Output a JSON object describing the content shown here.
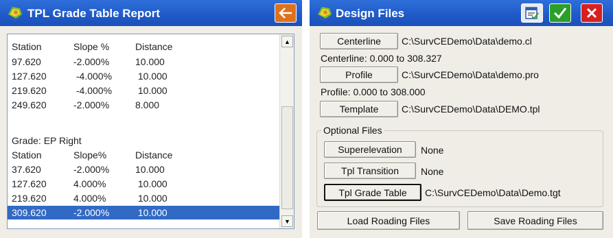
{
  "report_window": {
    "title": "TPL Grade Table Report",
    "rows": [
      {
        "station": "Station",
        "slope": "Slope %",
        "distance": "Distance"
      },
      {
        "station": "97.620",
        "slope": "-2.000%",
        "distance": "10.000"
      },
      {
        "station": "127.620",
        "slope": " -4.000%",
        "distance": " 10.000"
      },
      {
        "station": "219.620",
        "slope": " -4.000%",
        "distance": " 10.000"
      },
      {
        "station": "249.620",
        "slope": "-2.000%",
        "distance": "8.000"
      },
      {
        "station": "",
        "slope": "",
        "distance": ""
      },
      {
        "station": "Grade: EP Right",
        "slope": "",
        "distance": ""
      },
      {
        "station": "Station",
        "slope": "Slope%",
        "distance": "Distance"
      },
      {
        "station": "37.620",
        "slope": "-2.000%",
        "distance": "10.000"
      },
      {
        "station": "127.620",
        "slope": "4.000%",
        "distance": " 10.000"
      },
      {
        "station": "219.620",
        "slope": "4.000%",
        "distance": " 10.000"
      },
      {
        "station": "309.620",
        "slope": "-2.000%",
        "distance": " 10.000"
      }
    ],
    "selected_row": 11
  },
  "design_window": {
    "title": "Design Files",
    "centerline": {
      "button": "Centerline",
      "path": "C:\\SurvCEDemo\\Data\\demo.cl",
      "range": "Centerline: 0.000 to 308.327"
    },
    "profile": {
      "button": "Profile",
      "path": "C:\\SurvCEDemo\\Data\\demo.pro",
      "range": "Profile: 0.000 to 308.000"
    },
    "template": {
      "button": "Template",
      "path": "C:\\SurvCEDemo\\Data\\DEMO.tpl"
    },
    "optional": {
      "legend": "Optional Files",
      "superelevation": {
        "button": "Superelevation",
        "value": "None"
      },
      "tpl_transition": {
        "button": "Tpl Transition",
        "value": "None"
      },
      "tpl_grade_table": {
        "button": "Tpl Grade Table",
        "value": "C:\\SurvCEDemo\\Data\\Demo.tgt"
      }
    },
    "load_button": "Load Roading Files",
    "save_button": "Save Roading Files"
  },
  "colors": {
    "title_bar": "#1f59c8",
    "back_button": "#e0711a",
    "ok_button": "#2aa02a",
    "close_button": "#d82020",
    "selection": "#316ac5"
  },
  "icons": {
    "back": "back-arrow-icon",
    "ok": "checkmark-icon",
    "close": "close-x-icon",
    "note": "notepad-icon"
  }
}
